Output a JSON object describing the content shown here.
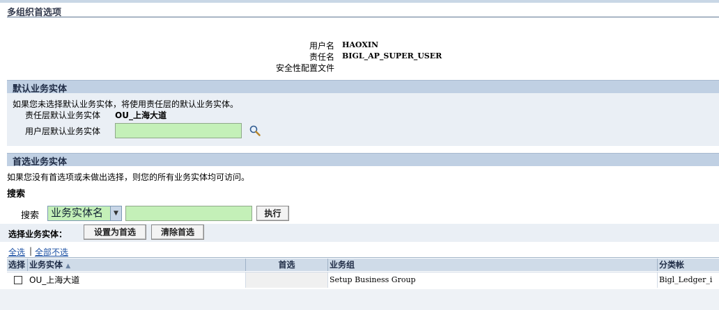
{
  "page_title": "多组织首选项",
  "user_info": {
    "username_label": "用户名",
    "username_value": "HAOXIN",
    "responsibility_label": "责任名",
    "responsibility_value": "BIGL_AP_SUPER_USER",
    "security_profile_label": "安全性配置文件"
  },
  "default_ou": {
    "header": "默认业务实体",
    "hint": "如果您未选择默认业务实体，将使用责任层的默认业务实体。",
    "resp_level_label": "责任层默认业务实体",
    "resp_level_value": "OU_上海大道",
    "user_level_label": "用户层默认业务实体",
    "user_level_value": ""
  },
  "preferred_ou": {
    "header": "首选业务实体",
    "hint": "如果您没有首选项或未做出选择，则您的所有业务实体均可访问。",
    "search_title": "搜索",
    "search_label": "搜索",
    "search_field_selected": "业务实体名",
    "search_value": "",
    "go_button": "执行",
    "select_label": "选择业务实体：",
    "set_preferred_button": "设置为首选",
    "clear_preferred_button": "清除首选",
    "select_all": "全选",
    "separator": "|",
    "select_none": "全部不选"
  },
  "table": {
    "headers": [
      "选择",
      "业务实体",
      "首选",
      "业务组",
      "分类帐"
    ],
    "rows": [
      {
        "name": "OU_上海大道",
        "preferred": "",
        "business_group": "Setup Business Group",
        "ledger": "Bigl_Ledger_i"
      }
    ]
  },
  "colors": {
    "field_bg": "#c4f0b8",
    "section_bg": "#eaeff5",
    "header_bg": "#c0d0e3",
    "link": "#1f53a5"
  }
}
